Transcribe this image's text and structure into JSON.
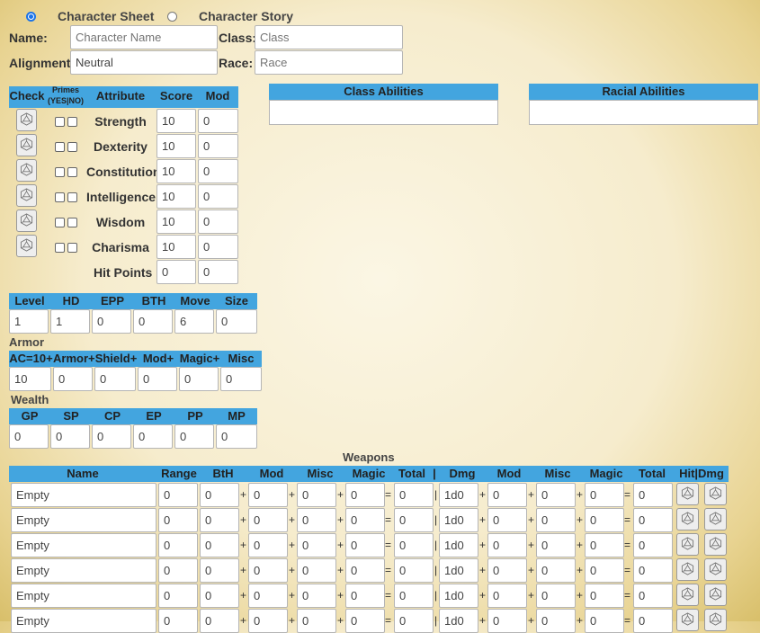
{
  "tabs": {
    "sheet": "Character Sheet",
    "story": "Character Story",
    "selected": "sheet"
  },
  "basic": {
    "name_label": "Name:",
    "name_placeholder": "Character Name",
    "class_label": "Class:",
    "class_placeholder": "Class",
    "alignment_label": "Alignment:",
    "alignment_value": "Neutral",
    "race_label": "Race:",
    "race_placeholder": "Race"
  },
  "attributes": {
    "headers": {
      "check": "Check",
      "primes_line1": "Primes",
      "primes_line2": "(YES|NO)",
      "attribute": "Attribute",
      "score": "Score",
      "mod": "Mod"
    },
    "rows": [
      {
        "name": "Strength",
        "score": "10",
        "mod": "0"
      },
      {
        "name": "Dexterity",
        "score": "10",
        "mod": "0"
      },
      {
        "name": "Constitution",
        "score": "10",
        "mod": "0"
      },
      {
        "name": "Intelligence",
        "score": "10",
        "mod": "0"
      },
      {
        "name": "Wisdom",
        "score": "10",
        "mod": "0"
      },
      {
        "name": "Charisma",
        "score": "10",
        "mod": "0"
      }
    ],
    "hit_points": {
      "label": "Hit Points",
      "score": "0",
      "mod": "0"
    }
  },
  "class_abilities": {
    "title": "Class Abilities"
  },
  "racial_abilities": {
    "title": "Racial Abilities"
  },
  "level_block": {
    "headers": [
      "Level",
      "HD",
      "EPP",
      "BTH",
      "Move",
      "Size"
    ],
    "values": [
      "1",
      "1",
      "0",
      "0",
      "6",
      "0"
    ]
  },
  "armor": {
    "title": "Armor",
    "headers": [
      "AC=10+",
      "Armor+",
      "Shield+",
      "Mod+",
      "Magic+",
      "Misc"
    ],
    "values": [
      "10",
      "0",
      "0",
      "0",
      "0",
      "0"
    ]
  },
  "wealth": {
    "title": "Wealth",
    "headers": [
      "GP",
      "SP",
      "CP",
      "EP",
      "PP",
      "MP"
    ],
    "values": [
      "0",
      "0",
      "0",
      "0",
      "0",
      "0"
    ]
  },
  "weapons": {
    "title": "Weapons",
    "headers": [
      "Name",
      "Range",
      "BtH",
      "Mod",
      "Misc",
      "Magic",
      "Total",
      "|",
      "Dmg",
      "Mod",
      "Misc",
      "Magic",
      "Total",
      "Hit|Dmg"
    ],
    "rows": [
      {
        "name": "Empty",
        "range": "0",
        "bth": "0",
        "mod": "0",
        "misc": "0",
        "magic": "0",
        "total": "0",
        "dmg": "1d0",
        "dmod": "0",
        "dmisc": "0",
        "dmagic": "0",
        "dtotal": "0"
      },
      {
        "name": "Empty",
        "range": "0",
        "bth": "0",
        "mod": "0",
        "misc": "0",
        "magic": "0",
        "total": "0",
        "dmg": "1d0",
        "dmod": "0",
        "dmisc": "0",
        "dmagic": "0",
        "dtotal": "0"
      },
      {
        "name": "Empty",
        "range": "0",
        "bth": "0",
        "mod": "0",
        "misc": "0",
        "magic": "0",
        "total": "0",
        "dmg": "1d0",
        "dmod": "0",
        "dmisc": "0",
        "dmagic": "0",
        "dtotal": "0"
      },
      {
        "name": "Empty",
        "range": "0",
        "bth": "0",
        "mod": "0",
        "misc": "0",
        "magic": "0",
        "total": "0",
        "dmg": "1d0",
        "dmod": "0",
        "dmisc": "0",
        "dmagic": "0",
        "dtotal": "0"
      },
      {
        "name": "Empty",
        "range": "0",
        "bth": "0",
        "mod": "0",
        "misc": "0",
        "magic": "0",
        "total": "0",
        "dmg": "1d0",
        "dmod": "0",
        "dmisc": "0",
        "dmagic": "0",
        "dtotal": "0"
      },
      {
        "name": "Empty",
        "range": "0",
        "bth": "0",
        "mod": "0",
        "misc": "0",
        "magic": "0",
        "total": "0",
        "dmg": "1d0",
        "dmod": "0",
        "dmisc": "0",
        "dmagic": "0",
        "dtotal": "0"
      }
    ],
    "symbols": {
      "plus": "+",
      "equals": "=",
      "bar": "|"
    }
  },
  "icons": {
    "roll": "d20-die-icon"
  },
  "colors": {
    "header_bar": "#43a5df",
    "parchment": "#f6eccd",
    "radio_selected": "#1a73e8"
  }
}
